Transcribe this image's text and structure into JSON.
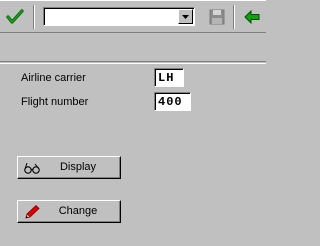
{
  "toolbar": {
    "enter_icon": "checkmark-icon",
    "command_field_value": "",
    "save_icon": "floppy-disk-icon",
    "back_icon": "green-arrow-left-icon"
  },
  "form": {
    "airline_label": "Airline carrier",
    "airline_value": "LH",
    "flight_label": "Flight number",
    "flight_value": "400"
  },
  "buttons": {
    "display_label": "Display",
    "display_icon": "glasses-icon",
    "change_label": "Change",
    "change_icon": "pencil-icon"
  },
  "colors": {
    "background": "#c0c0c0",
    "check_green": "#008000",
    "pencil_red": "#d00000"
  }
}
